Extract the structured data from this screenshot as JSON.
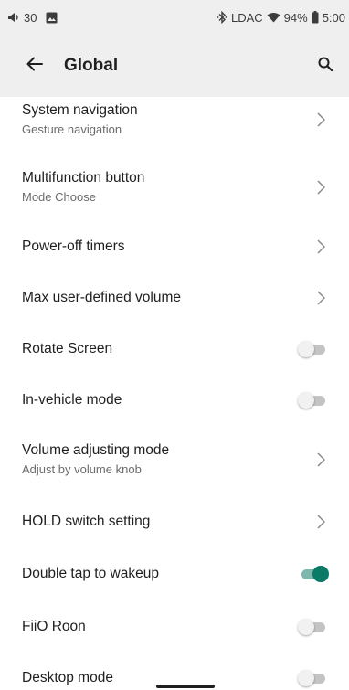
{
  "status_bar": {
    "volume_level": "30",
    "codec": "LDAC",
    "battery_percent": "94%",
    "time": "5:00",
    "icons": [
      "speaker-icon",
      "image-icon",
      "bluetooth-icon",
      "wifi-icon",
      "battery-icon"
    ]
  },
  "app_bar": {
    "title": "Global",
    "icons": [
      "back-arrow-icon",
      "search-icon"
    ]
  },
  "settings": {
    "system_navigation": {
      "title": "System navigation",
      "subtitle": "Gesture navigation"
    },
    "multifunction_button": {
      "title": "Multifunction button",
      "subtitle": "Mode Choose"
    },
    "power_off_timers": {
      "title": "Power-off timers"
    },
    "max_volume": {
      "title": "Max user-defined volume"
    },
    "rotate_screen": {
      "title": "Rotate Screen",
      "enabled": false
    },
    "in_vehicle_mode": {
      "title": "In-vehicle mode",
      "enabled": false
    },
    "volume_adjusting_mode": {
      "title": "Volume adjusting mode",
      "subtitle": "Adjust by volume knob"
    },
    "hold_switch": {
      "title": "HOLD switch setting"
    },
    "double_tap_wakeup": {
      "title": "Double tap to wakeup",
      "enabled": true
    },
    "fiio_roon": {
      "title": "FiiO Roon",
      "enabled": false
    },
    "desktop_mode": {
      "title": "Desktop mode",
      "enabled": false
    }
  },
  "colors": {
    "accent": "#0b7a66",
    "accent_track": "#7eb8ad",
    "header_background": "#efefef"
  }
}
